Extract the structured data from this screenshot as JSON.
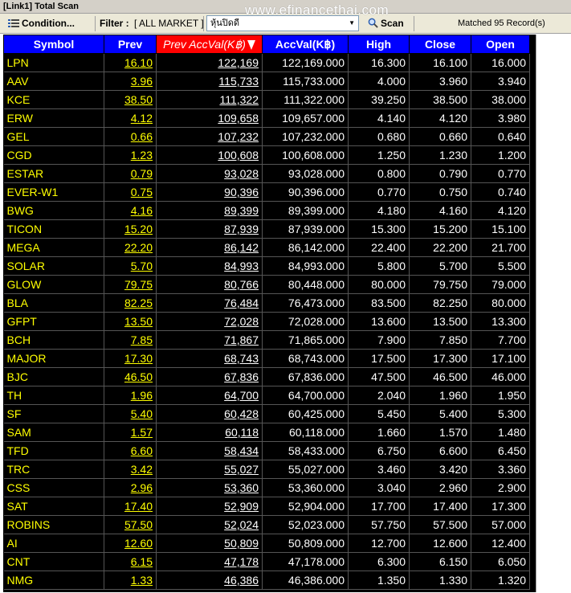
{
  "window": {
    "title": "[Link1] Total Scan"
  },
  "toolbar": {
    "condition_label": "Condition...",
    "filter_label": "Filter :",
    "market_label": "[ ALL MARKET ]",
    "select_value": "หุ้นปิดดี",
    "scan_label": "Scan",
    "matched_label": "Matched 95 Record(s)"
  },
  "watermark": "www.efinancethai.com",
  "table": {
    "columns": [
      "Symbol",
      "Prev",
      "Prev AccVal(K฿)",
      "AccVal(K฿)",
      "High",
      "Close",
      "Open"
    ],
    "sorted_column_index": 2,
    "rows": [
      [
        "LPN",
        "16.10",
        "122,169",
        "122,169.000",
        "16.300",
        "16.100",
        "16.000"
      ],
      [
        "AAV",
        "3.96",
        "115,733",
        "115,733.000",
        "4.000",
        "3.960",
        "3.940"
      ],
      [
        "KCE",
        "38.50",
        "111,322",
        "111,322.000",
        "39.250",
        "38.500",
        "38.000"
      ],
      [
        "ERW",
        "4.12",
        "109,658",
        "109,657.000",
        "4.140",
        "4.120",
        "3.980"
      ],
      [
        "GEL",
        "0.66",
        "107,232",
        "107,232.000",
        "0.680",
        "0.660",
        "0.640"
      ],
      [
        "CGD",
        "1.23",
        "100,608",
        "100,608.000",
        "1.250",
        "1.230",
        "1.200"
      ],
      [
        "ESTAR",
        "0.79",
        "93,028",
        "93,028.000",
        "0.800",
        "0.790",
        "0.770"
      ],
      [
        "EVER-W1",
        "0.75",
        "90,396",
        "90,396.000",
        "0.770",
        "0.750",
        "0.740"
      ],
      [
        "BWG",
        "4.16",
        "89,399",
        "89,399.000",
        "4.180",
        "4.160",
        "4.120"
      ],
      [
        "TICON",
        "15.20",
        "87,939",
        "87,939.000",
        "15.300",
        "15.200",
        "15.100"
      ],
      [
        "MEGA",
        "22.20",
        "86,142",
        "86,142.000",
        "22.400",
        "22.200",
        "21.700"
      ],
      [
        "SOLAR",
        "5.70",
        "84,993",
        "84,993.000",
        "5.800",
        "5.700",
        "5.500"
      ],
      [
        "GLOW",
        "79.75",
        "80,766",
        "80,448.000",
        "80.000",
        "79.750",
        "79.000"
      ],
      [
        "BLA",
        "82.25",
        "76,484",
        "76,473.000",
        "83.500",
        "82.250",
        "80.000"
      ],
      [
        "GFPT",
        "13.50",
        "72,028",
        "72,028.000",
        "13.600",
        "13.500",
        "13.300"
      ],
      [
        "BCH",
        "7.85",
        "71,867",
        "71,865.000",
        "7.900",
        "7.850",
        "7.700"
      ],
      [
        "MAJOR",
        "17.30",
        "68,743",
        "68,743.000",
        "17.500",
        "17.300",
        "17.100"
      ],
      [
        "BJC",
        "46.50",
        "67,836",
        "67,836.000",
        "47.500",
        "46.500",
        "46.000"
      ],
      [
        "TH",
        "1.96",
        "64,700",
        "64,700.000",
        "2.040",
        "1.960",
        "1.950"
      ],
      [
        "SF",
        "5.40",
        "60,428",
        "60,425.000",
        "5.450",
        "5.400",
        "5.300"
      ],
      [
        "SAM",
        "1.57",
        "60,118",
        "60,118.000",
        "1.660",
        "1.570",
        "1.480"
      ],
      [
        "TFD",
        "6.60",
        "58,434",
        "58,433.000",
        "6.750",
        "6.600",
        "6.450"
      ],
      [
        "TRC",
        "3.42",
        "55,027",
        "55,027.000",
        "3.460",
        "3.420",
        "3.360"
      ],
      [
        "CSS",
        "2.96",
        "53,360",
        "53,360.000",
        "3.040",
        "2.960",
        "2.900"
      ],
      [
        "SAT",
        "17.40",
        "52,909",
        "52,904.000",
        "17.700",
        "17.400",
        "17.300"
      ],
      [
        "ROBINS",
        "57.50",
        "52,024",
        "52,023.000",
        "57.750",
        "57.500",
        "57.000"
      ],
      [
        "AI",
        "12.60",
        "50,809",
        "50,809.000",
        "12.700",
        "12.600",
        "12.400"
      ],
      [
        "CNT",
        "6.15",
        "47,178",
        "47,178.000",
        "6.300",
        "6.150",
        "6.050"
      ],
      [
        "NMG",
        "1.33",
        "46,386",
        "46,386.000",
        "1.350",
        "1.330",
        "1.320"
      ]
    ]
  },
  "colors": {
    "header_bg": "#0000ff",
    "sorted_header_bg": "#ff0000",
    "grid_bg": "#000000",
    "symbol_text": "#ffff00",
    "value_text": "#ffffff"
  },
  "icons": {
    "condition": "list-icon",
    "scan": "search-icon",
    "sort": "sort-descending-icon",
    "dropdown": "chevron-down-icon"
  }
}
